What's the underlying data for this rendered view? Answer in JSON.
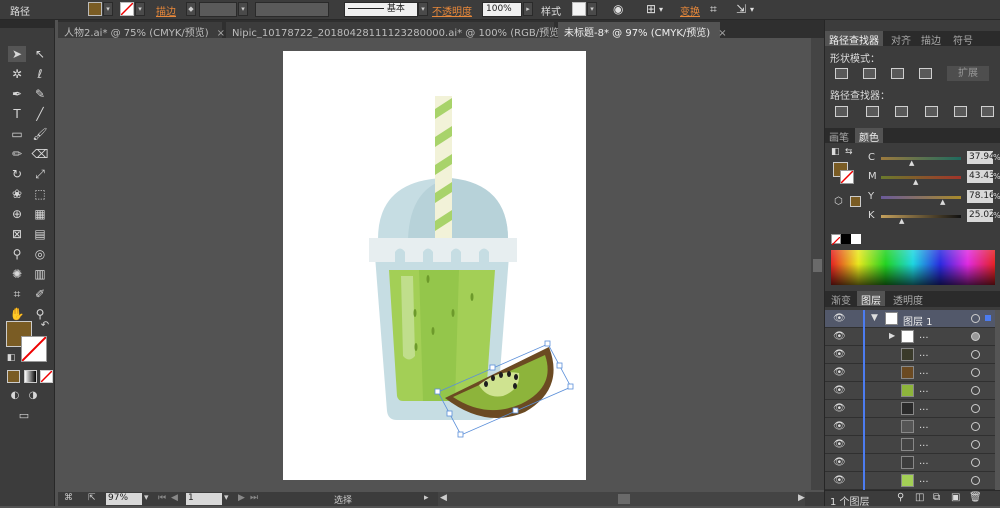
{
  "control_bar": {
    "mode_label": "路径",
    "stroke_label": "描边",
    "brush_label": "基本",
    "opacity_label": "不透明度",
    "opacity_value": "100%",
    "style_label": "样式",
    "transform_label": "变换",
    "fill_color": "#7a5c24"
  },
  "tabs": [
    {
      "label": "人物2.ai* @ 75% (CMYK/预览)",
      "close": "×"
    },
    {
      "label": "Nipic_10178722_20180428111123280000.ai* @ 100% (RGB/预览)",
      "close": "×"
    },
    {
      "label": "未标题-8* @ 97% (CMYK/预览)",
      "close": "×"
    }
  ],
  "status_bar": {
    "zoom": "97%",
    "page": "1",
    "tool_name": "选择"
  },
  "panel": {
    "pathfinder_tabs": [
      "路径查找器",
      "对齐",
      "描边",
      "符号"
    ],
    "shape_modes_label": "形状模式：",
    "expand_label": "扩展",
    "pathfinders_label": "路径查找器：",
    "color_tabs": [
      "画笔",
      "颜色"
    ],
    "cmyk": [
      {
        "channel": "C",
        "value": "37.94",
        "unit": "%"
      },
      {
        "channel": "M",
        "value": "43.43",
        "unit": "%"
      },
      {
        "channel": "Y",
        "value": "78.16",
        "unit": "%"
      },
      {
        "channel": "K",
        "value": "25.02",
        "unit": "%"
      }
    ],
    "layer_tabs": [
      "渐变",
      "图层",
      "透明度"
    ],
    "layer_name": "图层 1",
    "sublayer_dots": "...",
    "layer_count": "1 个图层"
  },
  "colors": {
    "fill": "#7a5c24",
    "kiwi_flesh": "#8db43b",
    "kiwi_skin": "#6b4a22",
    "drink_green": "#a3cf56",
    "cup": "#c6dde3",
    "selection": "#5b8fd9"
  }
}
